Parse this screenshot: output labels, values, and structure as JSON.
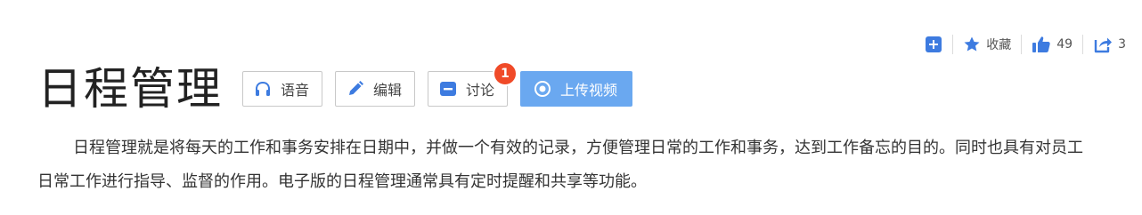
{
  "toolbar": {
    "favorite_label": "收藏",
    "like_count": "49",
    "share_count": "3"
  },
  "title": "日程管理",
  "buttons": {
    "voice": "语音",
    "edit": "编辑",
    "discuss": "讨论",
    "discuss_badge": "1",
    "upload": "上传视频"
  },
  "description": "日程管理就是将每天的工作和事务安排在日期中，并做一个有效的记录，方便管理日常的工作和事务，达到工作备忘的目的。同时也具有对员工日常工作进行指导、监督的作用。电子版的日程管理通常具有定时提醒和共享等功能。",
  "colors": {
    "accent": "#3d7be0",
    "primary_button": "#6aa8f0",
    "badge": "#f04a28"
  }
}
